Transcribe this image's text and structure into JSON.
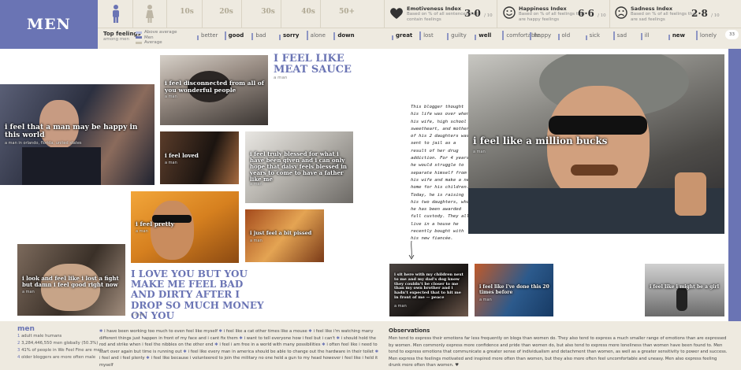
{
  "header": {
    "title": "MEN",
    "ages": [
      "10s",
      "20s",
      "30s",
      "40s",
      "50+"
    ],
    "top_feelings_label": "Top feelings",
    "top_feelings_sub": "among men",
    "legend": [
      "Above average",
      "Men",
      "Average"
    ],
    "feelings_left": [
      "better",
      "good",
      "bad",
      "sorry",
      "alone",
      "down"
    ],
    "feelings_bold_left": [
      false,
      true,
      false,
      true,
      false,
      true
    ],
    "feelings_right": [
      "great",
      "lost",
      "guilty",
      "well",
      "comfortable",
      "happy",
      "old",
      "sick",
      "sad",
      "ill",
      "new",
      "lonely"
    ],
    "feelings_bold_right": [
      true,
      false,
      false,
      true,
      false,
      false,
      false,
      false,
      false,
      false,
      true,
      false
    ],
    "page_number": "33",
    "colors": {
      "accent": "#6a74b4",
      "bar": "#eeeae0"
    }
  },
  "indices": [
    {
      "icon": "heart-icon",
      "title": "Emotiveness Index",
      "desc": "Based on % of all sentences that contain feelings",
      "value": "3·0",
      "of": "/ 10"
    },
    {
      "icon": "smiley-happy-icon",
      "title": "Happiness Index",
      "desc": "Based on % of all feelings that are happy feelings",
      "value": "6·6",
      "of": "/ 10"
    },
    {
      "icon": "smiley-sad-icon",
      "title": "Sadness Index",
      "desc": "Based on % of all feelings that are sad feelings",
      "value": "2·8",
      "of": "/ 10"
    }
  ],
  "photos": {
    "p1": {
      "caption": "i feel that a man may be happy in this world",
      "byline": "a man in orlando, florida, united states"
    },
    "p2": {
      "caption": "i feel disconnected from all of you wonderful people",
      "byline": "a man"
    },
    "p3": {
      "caption": "i feel loved",
      "byline": "a man"
    },
    "p4": {
      "caption": "i feel truly blessed for what i have been given and i can only hope that daisy feels blessed in years to come to have a father like me",
      "byline": "a man"
    },
    "p5": {
      "caption": "i feel pretty",
      "byline": "a man"
    },
    "p6": {
      "caption": "i just feel a bit pissed",
      "byline": "a man"
    },
    "p7": {
      "caption": "i look and feel like i lost a fight but damn i feel good right now",
      "byline": "a man"
    },
    "p8": {
      "caption": "i feel like a million bucks",
      "byline": "a man"
    },
    "p9": {
      "caption": "i sit here with my children next to me and my dad's dog know they couldn't be closer to me than my own brother and i hadn't expected that to hit me in front of me — peace",
      "byline": "a man"
    },
    "p10": {
      "caption": "i feel like i've done this 20 times before",
      "byline": "a man"
    },
    "p11": {
      "caption": "i feel like i might be a girl",
      "byline": "a man"
    }
  },
  "quotes": {
    "q1": {
      "text": "I FEEL LIKE MEAT SAUCE",
      "byline": "a man"
    },
    "q2": {
      "text": "I LOVE YOU BUT YOU MAKE ME FEEL BAD AND DIRTY AFTER I DROP SO MUCH MONEY ON YOU",
      "byline": "a man"
    }
  },
  "note": "This blogger thought his life was over when his wife, high school sweetheart, and mother of his 2 daughters was sent to jail as a result of her drug addiction. For 4 years he would struggle to separate himself from his wife and make a new home for his children. Today, he is raising his two daughters, whom he has been awarded full custody. They all live in a house he recently bought with his new fiancée.",
  "bottom": {
    "title": "men",
    "stats": [
      {
        "num": "1",
        "text": "adult male humans"
      },
      {
        "num": "2",
        "text": "3,284,446,550 men globally (50.3%)"
      },
      {
        "num": "3",
        "text": "41% of people in We Feel Fine are men"
      },
      {
        "num": "4",
        "text": "older bloggers are more often male"
      }
    ],
    "feelings": [
      "i have been working too much to even feel like myself",
      "i feel like a cat other times like a mouse",
      "i feel like i'm watching many different things just happen in front of my face and i cant fix them",
      "i want to tell everyone how i feel but i can't",
      "i should hold the rod and strike when i feel the nibbles on the other end",
      "i feel i am free in a world with many possibilities",
      "i often feel like i need to start over again but time is running out",
      "i feel like every man in america should be able to change out the hardware in their toilet",
      "i feel and i feel plenty",
      "i feel like because i volunteered to join the military no one held a gun to my head however i feel like i held it myself"
    ],
    "obs_title": "Observations",
    "obs_text": "Men tend to express their emotions far less frequently on blogs than women do. They also tend to express a much smaller range of emotions than are expressed by women. Men commonly express more confidence and pride than women do, but also tend to express more loneliness than women have been found to. Men tend to express emotions that communicate a greater sense of individualism and detachment than women, as well as a greater sensitivity to power and success. Men express the feelings motivated and inspired more often than women, but they also more often feel uncomfortable and uneasy. Men also express feeling drunk more often than women. ♥"
  }
}
